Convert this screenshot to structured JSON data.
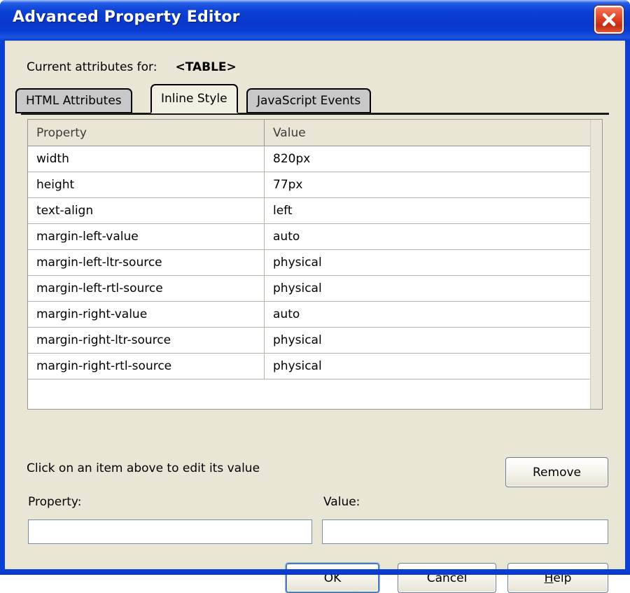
{
  "window": {
    "title": "Advanced Property Editor",
    "close_icon": "close-icon",
    "frame_color": "#0a3bcf",
    "body_color": "#eae6d6"
  },
  "header": {
    "label": "Current attributes for:",
    "target_element": "<TABLE>"
  },
  "tabs": [
    {
      "label": "HTML Attributes",
      "active": false
    },
    {
      "label": "Inline Style",
      "active": true
    },
    {
      "label": "JavaScript Events",
      "active": false
    }
  ],
  "property_table": {
    "columns": [
      "Property",
      "Value"
    ],
    "rows": [
      {
        "property": "width",
        "value": "820px"
      },
      {
        "property": "height",
        "value": "77px"
      },
      {
        "property": "text-align",
        "value": "left"
      },
      {
        "property": "margin-left-value",
        "value": "auto"
      },
      {
        "property": "margin-left-ltr-source",
        "value": "physical"
      },
      {
        "property": "margin-left-rtl-source",
        "value": "physical"
      },
      {
        "property": "margin-right-value",
        "value": "auto"
      },
      {
        "property": "margin-right-ltr-source",
        "value": "physical"
      },
      {
        "property": "margin-right-rtl-source",
        "value": "physical"
      }
    ]
  },
  "editor": {
    "hint": "Click on an item above to edit its value",
    "remove_label": "Remove",
    "property_label": "Property:",
    "value_label": "Value:",
    "property_input_value": "",
    "value_input_value": "",
    "property_input_placeholder": "",
    "value_input_placeholder": ""
  },
  "footer": {
    "ok_label": "OK",
    "cancel_label": "Cancel",
    "help_label": "Help",
    "help_accel": "H",
    "help_rest": "elp"
  }
}
